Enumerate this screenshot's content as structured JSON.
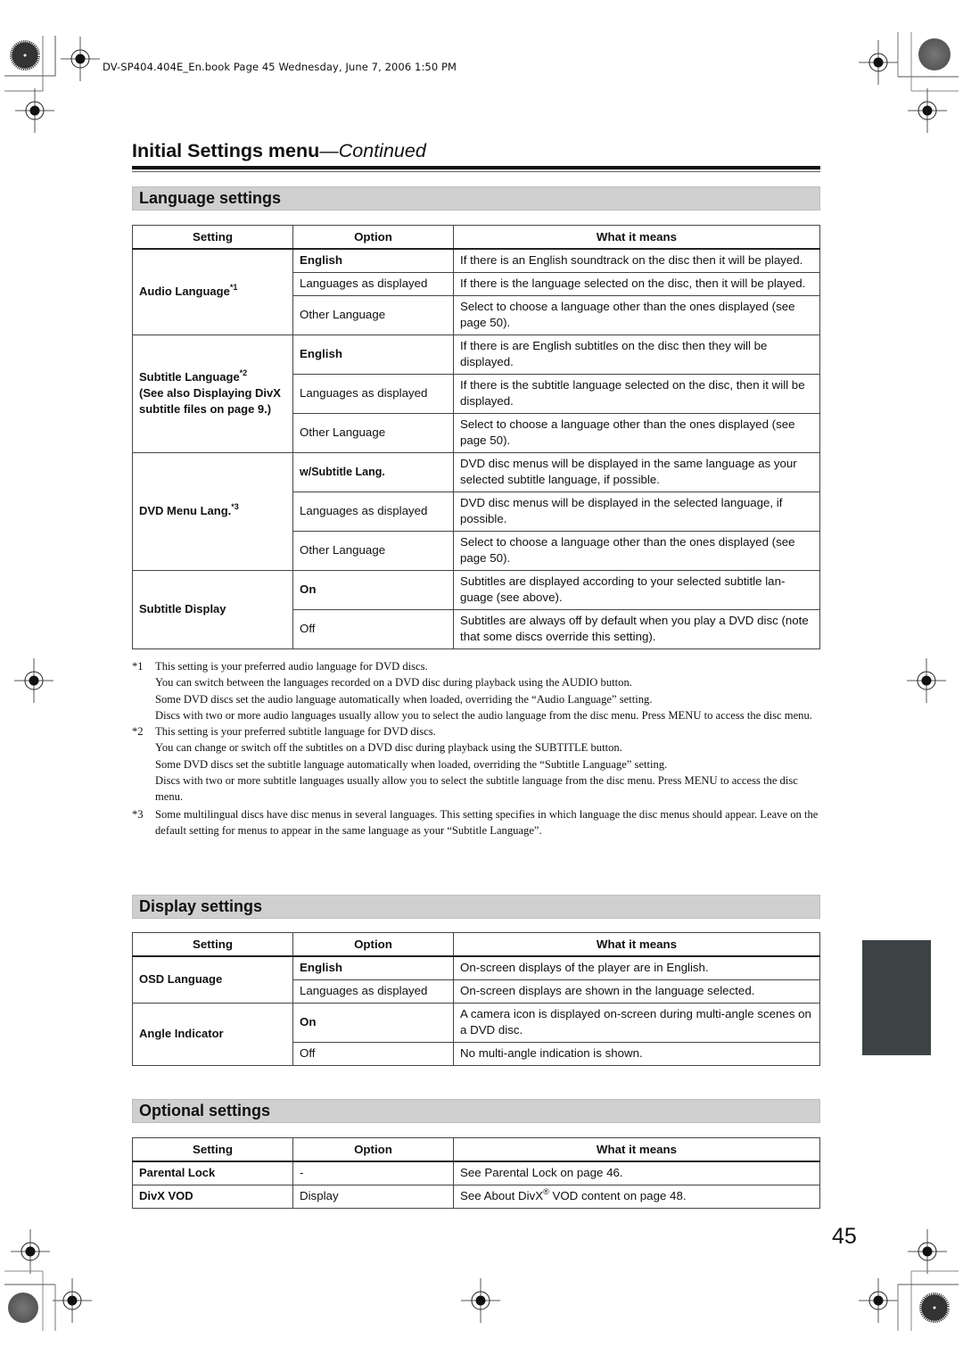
{
  "header": {
    "slug": "DV-SP404.404E_En.book  Page 45  Wednesday, June 7, 2006  1:50 PM",
    "title_main": "Initial Settings menu",
    "title_cont": "—Continued"
  },
  "columns": {
    "setting": "Setting",
    "option": "Option",
    "meaning": "What it means"
  },
  "language_settings": {
    "heading": "Language settings",
    "groups": [
      {
        "setting": "Audio Language",
        "sup": "*1",
        "rows": [
          {
            "option": "English",
            "bold": true,
            "meaning": "If there is an English soundtrack on the disc then it will be played."
          },
          {
            "option": "Languages as displayed",
            "bold": false,
            "meaning": "If there is the language selected on the disc, then it will be played."
          },
          {
            "option": "Other Language",
            "bold": false,
            "meaning": "Select to choose a language other than the ones displayed (see page 50)."
          }
        ]
      },
      {
        "setting": "Subtitle Language",
        "sup": "*2",
        "setting_note": "(See also Displaying DivX subtitle files on page 9.)",
        "rows": [
          {
            "option": "English",
            "bold": true,
            "meaning": "If there is are English subtitles on the disc then they will be displayed."
          },
          {
            "option": "Languages as displayed",
            "bold": false,
            "meaning": "If there is the subtitle language selected on the disc, then it will be displayed."
          },
          {
            "option": "Other Language",
            "bold": false,
            "meaning": "Select to choose a language other than the ones displayed (see page 50)."
          }
        ]
      },
      {
        "setting": "DVD Menu Lang.",
        "sup": "*3",
        "rows": [
          {
            "option": "w/Subtitle Lang.",
            "bold": true,
            "meaning": "DVD disc menus will be displayed in the same language as your selected subtitle language, if possible."
          },
          {
            "option": "Languages as displayed",
            "bold": false,
            "meaning": "DVD disc menus will be displayed in the selected language, if possible."
          },
          {
            "option": "Other Language",
            "bold": false,
            "meaning": "Select to choose a language other than the ones displayed (see page 50)."
          }
        ]
      },
      {
        "setting": "Subtitle Display",
        "sup": "",
        "rows": [
          {
            "option": "On",
            "bold": true,
            "meaning": "Subtitles are displayed according to your selected subtitle lan-guage (see above)."
          },
          {
            "option": "Off",
            "bold": false,
            "meaning": "Subtitles are always off by default when you play a DVD disc (note that some discs override this setting)."
          }
        ]
      }
    ]
  },
  "footnotes": [
    {
      "marker": "*1",
      "lines": [
        "This setting is your preferred audio language for DVD discs.",
        "You can switch between the languages recorded on a DVD disc during playback using the AUDIO button.",
        "Some DVD discs set the audio language automatically when loaded, overriding the “Audio Language” setting.",
        "Discs with two or more audio languages usually allow you to select the audio language from the disc menu. Press MENU to access the disc menu."
      ]
    },
    {
      "marker": "*2",
      "lines": [
        "This setting is your preferred subtitle language for DVD discs.",
        "You can change or switch off the subtitles on a DVD disc during playback using the SUBTITLE button.",
        "Some DVD discs set the subtitle language automatically when loaded, overriding the “Subtitle Language” setting.",
        "Discs with two or more subtitle languages usually allow you to select the subtitle language from the disc menu. Press MENU to access the disc menu."
      ]
    },
    {
      "marker": "*3",
      "lines": [
        "Some multilingual discs have disc menus in several languages. This setting specifies in which language the disc menus should appear. Leave on the default setting for menus to appear in the same language as your “Subtitle Language”."
      ]
    }
  ],
  "display_settings": {
    "heading": "Display settings",
    "groups": [
      {
        "setting": "OSD Language",
        "rows": [
          {
            "option": "English",
            "bold": true,
            "meaning": "On-screen displays of the player are in English."
          },
          {
            "option": "Languages as displayed",
            "bold": false,
            "meaning": "On-screen displays are shown in the language selected."
          }
        ]
      },
      {
        "setting": "Angle Indicator",
        "rows": [
          {
            "option": "On",
            "bold": true,
            "meaning": "A camera icon is displayed on-screen during multi-angle scenes on a DVD disc."
          },
          {
            "option": "Off",
            "bold": false,
            "meaning": "No multi-angle indication is shown."
          }
        ]
      }
    ]
  },
  "optional_settings": {
    "heading": "Optional settings",
    "rows": [
      {
        "setting": "Parental Lock",
        "option": "-",
        "meaning": "See Parental Lock on page 46."
      },
      {
        "setting": "DivX VOD",
        "option": "Display",
        "meaning_pre": "See About DivX",
        "meaning_sup": "®",
        "meaning_post": " VOD content on page 48."
      }
    ]
  },
  "page_number": "45",
  "colors": {
    "section_bg": "#cfcfcf",
    "side_tab": "#3d4446",
    "rule": "#111111"
  }
}
